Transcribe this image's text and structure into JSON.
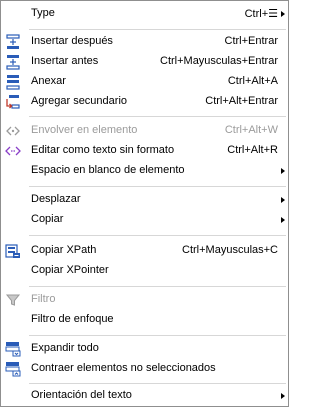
{
  "menu": {
    "items": [
      {
        "label": "Type",
        "shortcut": "Ctrl+☰",
        "icon": "none",
        "submenu": true,
        "enabled": true
      },
      {
        "label": "Insertar después",
        "shortcut": "Ctrl+Entrar",
        "icon": "insert-after-icon",
        "submenu": false,
        "enabled": true
      },
      {
        "label": "Insertar antes",
        "shortcut": "Ctrl+Mayusculas+Entrar",
        "icon": "insert-before-icon",
        "submenu": false,
        "enabled": true
      },
      {
        "label": "Anexar",
        "shortcut": "Ctrl+Alt+A",
        "icon": "append-icon",
        "submenu": false,
        "enabled": true
      },
      {
        "label": "Agregar secundario",
        "shortcut": "Ctrl+Alt+Entrar",
        "icon": "add-child-icon",
        "submenu": false,
        "enabled": true
      },
      {
        "label": "Envolver en elemento",
        "shortcut": "Ctrl+Alt+W",
        "icon": "wrap-element-icon",
        "submenu": false,
        "enabled": false
      },
      {
        "label": "Editar como texto sin formato",
        "shortcut": "Ctrl+Alt+R",
        "icon": "edit-raw-text-icon",
        "submenu": false,
        "enabled": true
      },
      {
        "label": "Espacio en blanco de elemento",
        "shortcut": "",
        "icon": "none",
        "submenu": true,
        "enabled": true
      },
      {
        "label": "Desplazar",
        "shortcut": "",
        "icon": "none",
        "submenu": true,
        "enabled": true
      },
      {
        "label": "Copiar",
        "shortcut": "",
        "icon": "none",
        "submenu": true,
        "enabled": true
      },
      {
        "label": "Copiar XPath",
        "shortcut": "Ctrl+Mayusculas+C",
        "icon": "copy-xpath-icon",
        "submenu": false,
        "enabled": true
      },
      {
        "label": "Copiar XPointer",
        "shortcut": "",
        "icon": "none",
        "submenu": false,
        "enabled": true
      },
      {
        "label": "Filtro",
        "shortcut": "",
        "icon": "filter-icon",
        "submenu": false,
        "enabled": false
      },
      {
        "label": "Filtro de enfoque",
        "shortcut": "",
        "icon": "none",
        "submenu": false,
        "enabled": true
      },
      {
        "label": "Expandir todo",
        "shortcut": "",
        "icon": "expand-all-icon",
        "submenu": false,
        "enabled": true
      },
      {
        "label": "Contraer elementos no seleccionados",
        "shortcut": "",
        "icon": "collapse-unselected-icon",
        "submenu": false,
        "enabled": true
      },
      {
        "label": "Orientación del texto",
        "shortcut": "",
        "icon": "none",
        "submenu": true,
        "enabled": true
      }
    ]
  },
  "colors": {
    "icon_blue": "#2a5cb8",
    "icon_purple": "#8a3fc8",
    "icon_gray": "#9b9b9b",
    "icon_red": "#c0392b",
    "disabled_text": "#9b9b9b",
    "separator": "#d7d7d7"
  }
}
